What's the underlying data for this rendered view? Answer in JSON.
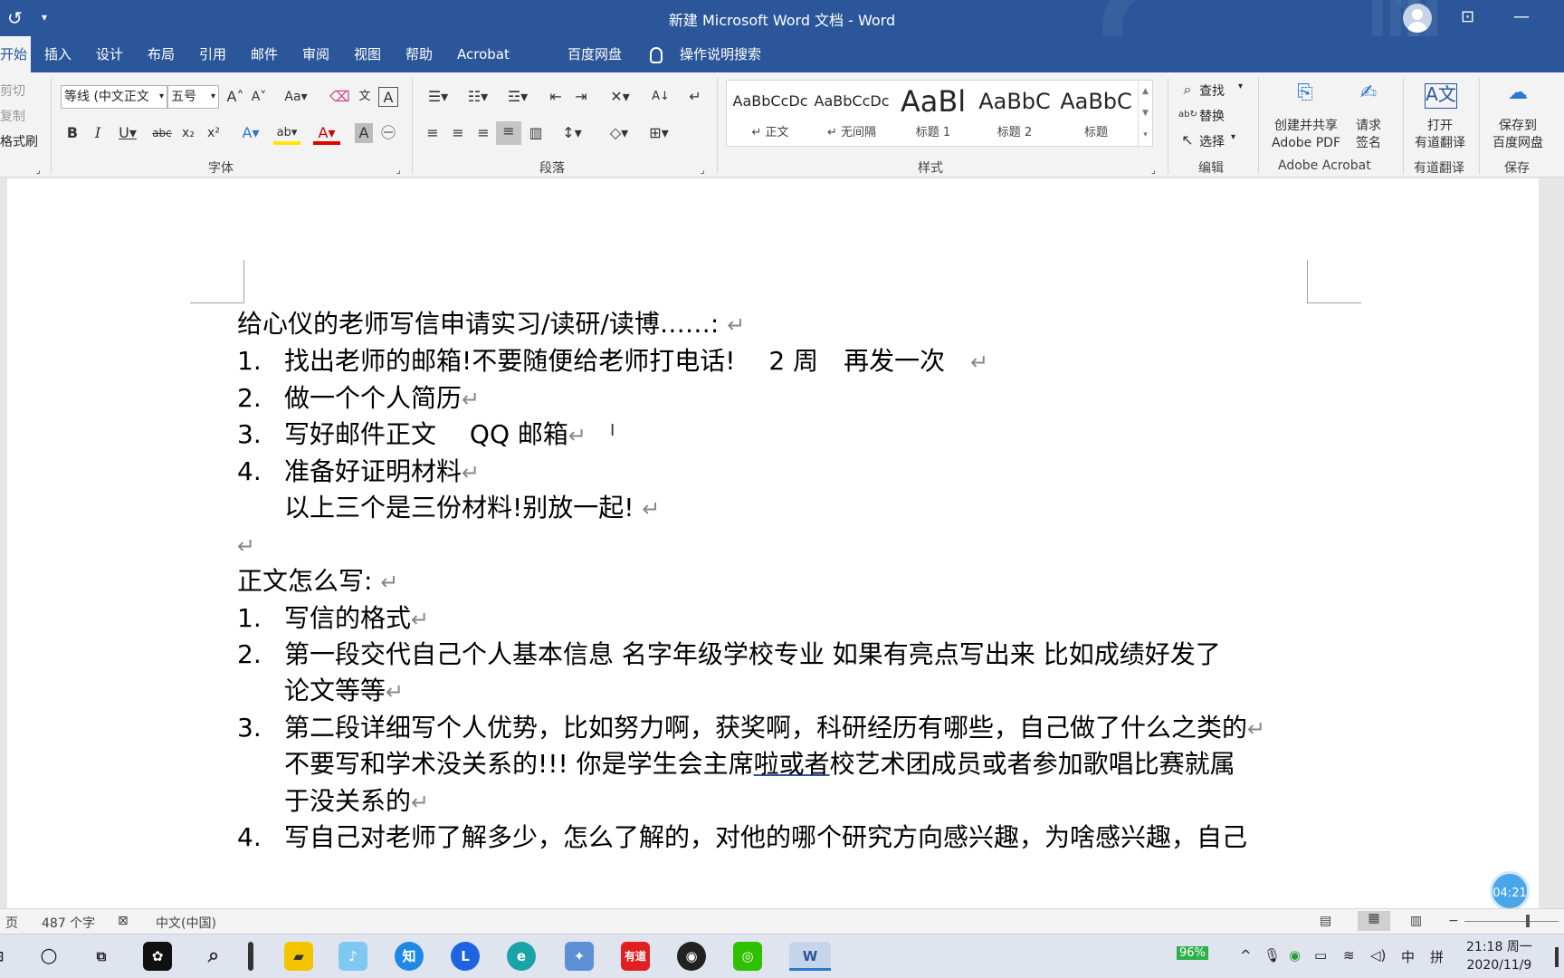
{
  "window": {
    "title": "新建 Microsoft Word 文档 - Word"
  },
  "tabs": [
    "开始",
    "插入",
    "设计",
    "布局",
    "引用",
    "邮件",
    "审阅",
    "视图",
    "帮助",
    "Acrobat",
    "百度网盘"
  ],
  "search_tab": "操作说明搜索",
  "clipboard": {
    "cut": "剪切",
    "copy": "复制",
    "format_painter": "格式刷"
  },
  "font": {
    "name": "等线 (中文正文",
    "size": "五号",
    "group_label": "字体"
  },
  "paragraph": {
    "group_label": "段落"
  },
  "styles": {
    "group_label": "样式",
    "items": [
      {
        "preview": "AaBbCcDc",
        "name": "↵ 正文"
      },
      {
        "preview": "AaBbCcDc",
        "name": "↵ 无间隔"
      },
      {
        "preview": "AaBl",
        "name": "标题 1"
      },
      {
        "preview": "AaBbC",
        "name": "标题 2"
      },
      {
        "preview": "AaBbC",
        "name": "标题"
      }
    ]
  },
  "editing": {
    "find": "查找",
    "replace": "替换",
    "select": "选择",
    "group_label": "编辑"
  },
  "acrobat": {
    "create_share": "创建并共享",
    "adobe_pdf": "Adobe PDF",
    "request": "请求",
    "sign": "签名",
    "group_label": "Adobe Acrobat"
  },
  "youdao": {
    "open": "打开",
    "translate": "有道翻译",
    "group_label": "有道翻译"
  },
  "save": {
    "save_to": "保存到",
    "baidu": "百度网盘",
    "group_label": "保存"
  },
  "document": {
    "heading1": "给心仪的老师写信申请实习/读研/读博……:",
    "list1": [
      {
        "n": "1.",
        "text": "找出老师的邮箱!不要随便给老师打电话!",
        "extra": "2 周　再发一次"
      },
      {
        "n": "2.",
        "text": "做一个个人简历"
      },
      {
        "n": "3.",
        "text": "写好邮件正文　 QQ 邮箱"
      },
      {
        "n": "4.",
        "text": "准备好证明材料"
      }
    ],
    "note": "以上三个是三份材料!别放一起!",
    "heading2": "正文怎么写:",
    "list2": [
      {
        "n": "1.",
        "lines": [
          "写信的格式"
        ]
      },
      {
        "n": "2.",
        "lines": [
          "第一段交代自己个人基本信息 名字年级学校专业 如果有亮点写出来 比如成绩好发了",
          "论文等等"
        ]
      },
      {
        "n": "3.",
        "lines": [
          "第二段详细写个人优势，比如努力啊，获奖啊，科研经历有哪些，自己做了什么之类的",
          "不要写和学术没关系的!!! 你是学生会主席",
          "于没关系的"
        ],
        "underlined": "啦或者",
        "after_underline": "校艺术团成员或者参加歌唱比赛就属"
      },
      {
        "n": "4.",
        "lines": [
          "写自己对老师了解多少，怎么了解的，对他的哪个研究方向感兴趣，为啥感兴趣，自己"
        ]
      }
    ]
  },
  "timer": "04:21",
  "status": {
    "page": "页",
    "words": "487 个字",
    "lang": "中文(中国)"
  },
  "tray": {
    "battery": "96%",
    "ime1": "中",
    "ime2": "拼",
    "time": "21:18 周一",
    "date": "2020/11/9"
  },
  "taskbar_apps": [
    "有道"
  ]
}
